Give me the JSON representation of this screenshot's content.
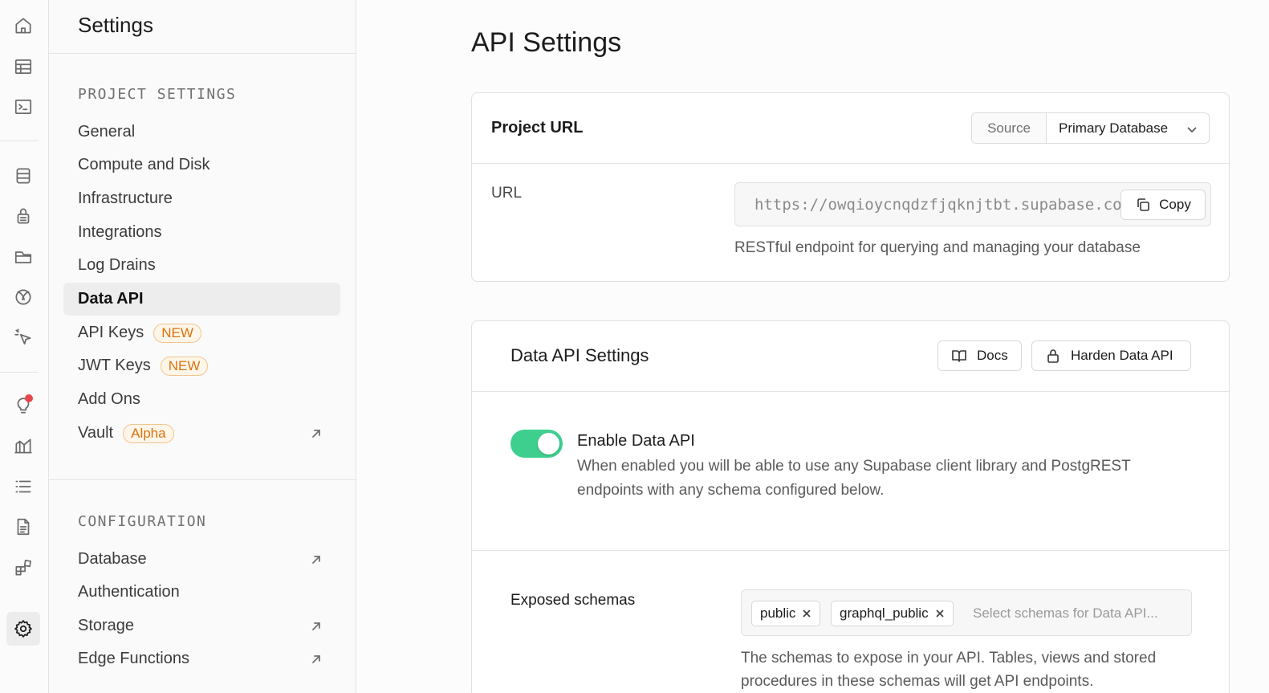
{
  "sidebar": {
    "title": "Settings",
    "groups": [
      {
        "title": "PROJECT SETTINGS",
        "items": [
          {
            "label": "General"
          },
          {
            "label": "Compute and Disk"
          },
          {
            "label": "Infrastructure"
          },
          {
            "label": "Integrations"
          },
          {
            "label": "Log Drains"
          },
          {
            "label": "Data API"
          },
          {
            "label": "API Keys",
            "badge": "NEW"
          },
          {
            "label": "JWT Keys",
            "badge": "NEW"
          },
          {
            "label": "Add Ons"
          },
          {
            "label": "Vault",
            "badge": "Alpha"
          }
        ]
      },
      {
        "title": "CONFIGURATION",
        "items": [
          {
            "label": "Database"
          },
          {
            "label": "Authentication"
          },
          {
            "label": "Storage"
          },
          {
            "label": "Edge Functions"
          }
        ]
      }
    ]
  },
  "rail_icons": [
    "home-icon",
    "table-editor-icon",
    "sql-editor-icon",
    "database-icon",
    "authentication-icon",
    "storage-icon",
    "realtime-icon",
    "edge-functions-icon",
    "advisors-icon",
    "reports-icon",
    "logs-icon",
    "api-docs-icon",
    "integrations-icon",
    "settings-icon"
  ],
  "page": {
    "title": "API Settings"
  },
  "project_url_card": {
    "title": "Project URL",
    "source_label": "Source",
    "source_value": "Primary Database",
    "url_label": "URL",
    "url_value": "https://owqioycnqdzfjqknjtbt.supabase.co",
    "copy_label": "Copy",
    "url_help": "RESTful endpoint for querying and managing your database"
  },
  "data_api_card": {
    "title": "Data API Settings",
    "docs_label": "Docs",
    "harden_label": "Harden Data API",
    "enable": {
      "on": true,
      "title": "Enable Data API",
      "description": "When enabled you will be able to use any Supabase client library and PostgREST endpoints with any schema configured below."
    },
    "schemas": {
      "label": "Exposed schemas",
      "chips": [
        "public",
        "graphql_public"
      ],
      "placeholder": "Select schemas for Data API...",
      "help": "The schemas to expose in your API. Tables, views and stored procedures in these schemas will get API endpoints."
    }
  },
  "colors": {
    "accent": "#3ecf8e",
    "badge": "#d9730d",
    "notification": "#e5484d"
  }
}
